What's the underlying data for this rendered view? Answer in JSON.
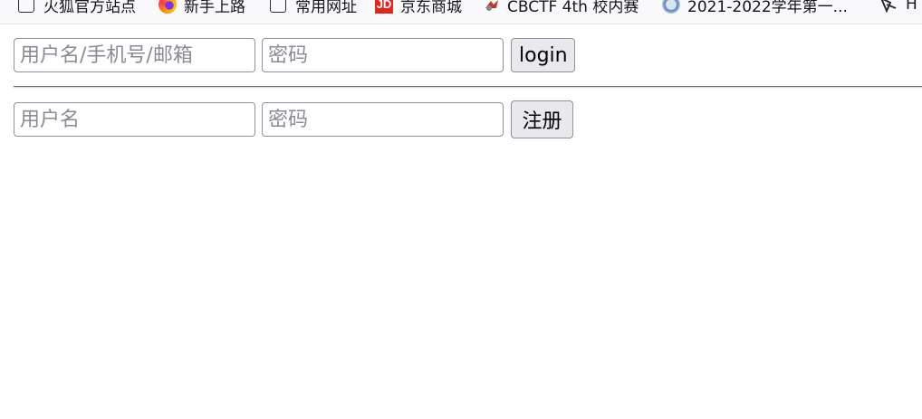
{
  "bookmarks": [
    {
      "label": "火狐官方站点",
      "icon": "folder-icon"
    },
    {
      "label": "新手上路",
      "icon": "firefox-icon"
    },
    {
      "label": "常用网址",
      "icon": "folder-icon"
    },
    {
      "label": "京东商城",
      "icon": "jd-icon"
    },
    {
      "label": "CBCTF 4th 校内赛",
      "icon": "cbctf-icon"
    },
    {
      "label": "2021-2022学年第一...",
      "icon": "university-icon"
    },
    {
      "label": "H",
      "icon": "h-site-icon"
    }
  ],
  "icon_text": {
    "jd": "JD"
  },
  "login_form": {
    "username_placeholder": "用户名/手机号/邮箱",
    "password_placeholder": "密码",
    "submit_label": "login"
  },
  "register_form": {
    "username_placeholder": "用户名",
    "password_placeholder": "密码",
    "submit_label": "注册"
  },
  "colors": {
    "button_bg": "#e9e9ed",
    "field_border": "#8f8f9d",
    "placeholder": "#8a8a94",
    "jd_red": "#e1251b"
  }
}
